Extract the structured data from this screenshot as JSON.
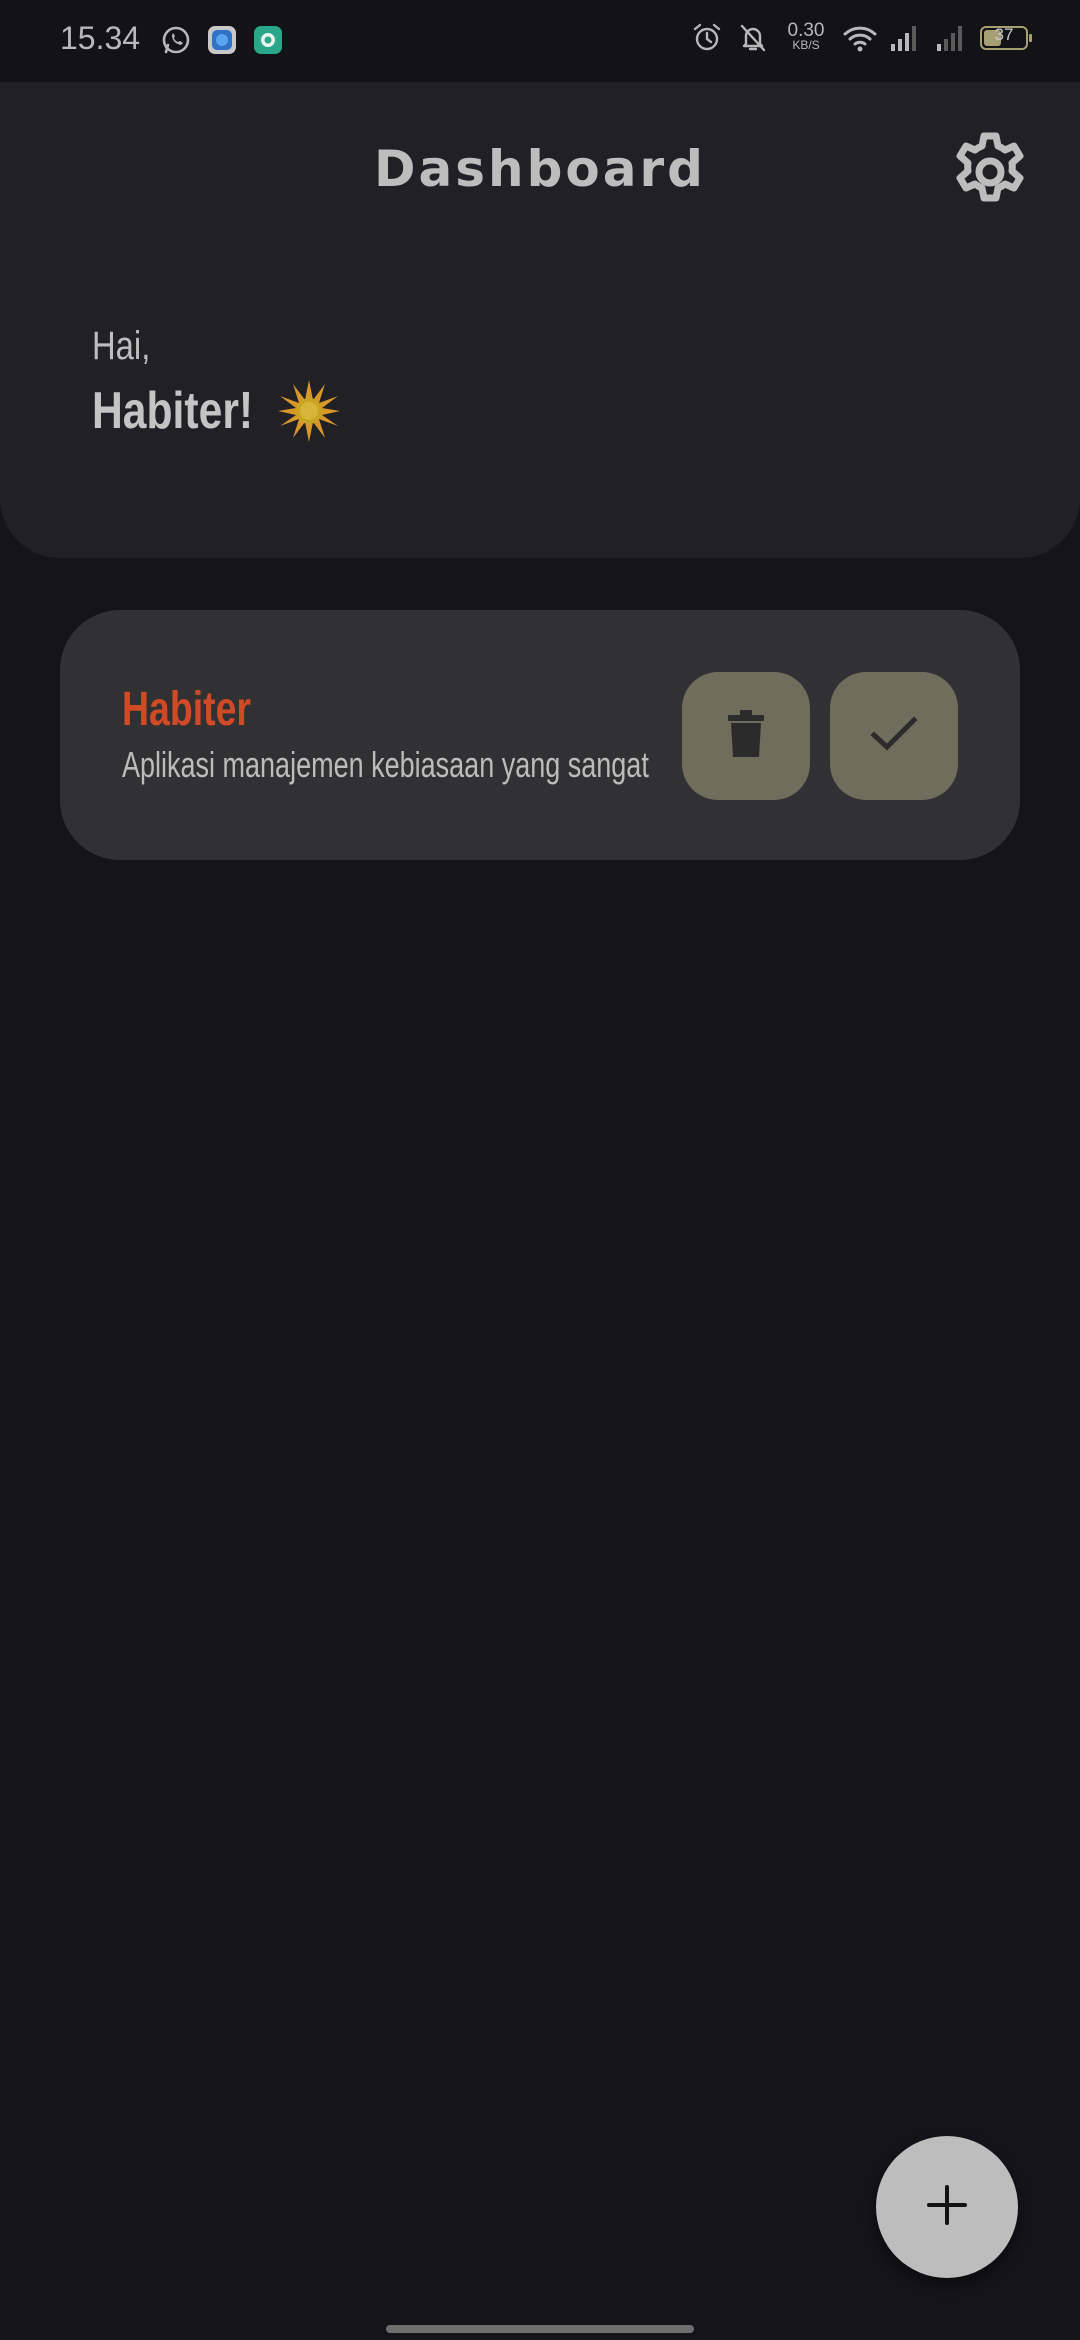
{
  "status_bar": {
    "time": "15.34",
    "net_speed_value": "0.30",
    "net_speed_unit": "KB/S",
    "battery_level": "37",
    "icons": [
      "whatsapp-icon",
      "app-icon-blue",
      "app-icon-teal",
      "alarm-icon",
      "bell-off-icon",
      "wifi-icon",
      "signal-icon",
      "signal-weak-icon",
      "battery-icon"
    ]
  },
  "header": {
    "title": "Dashboard",
    "settings_icon": "gear-icon"
  },
  "greeting": {
    "hi": "Hai,",
    "name": "Habiter!",
    "emoji_icon": "sun-icon"
  },
  "habits": [
    {
      "title": "Habiter",
      "description": "Aplikasi manajemen kebiasaan yang sangat",
      "delete_icon": "trash-icon",
      "done_icon": "check-icon"
    }
  ],
  "fab": {
    "icon": "plus-icon"
  },
  "colors": {
    "background": "#141419",
    "header_panel": "#212125",
    "card": "#313133",
    "habit_title": "#d04a26",
    "action_button": "#6f6d5c",
    "fab": "#bdbdbd"
  }
}
